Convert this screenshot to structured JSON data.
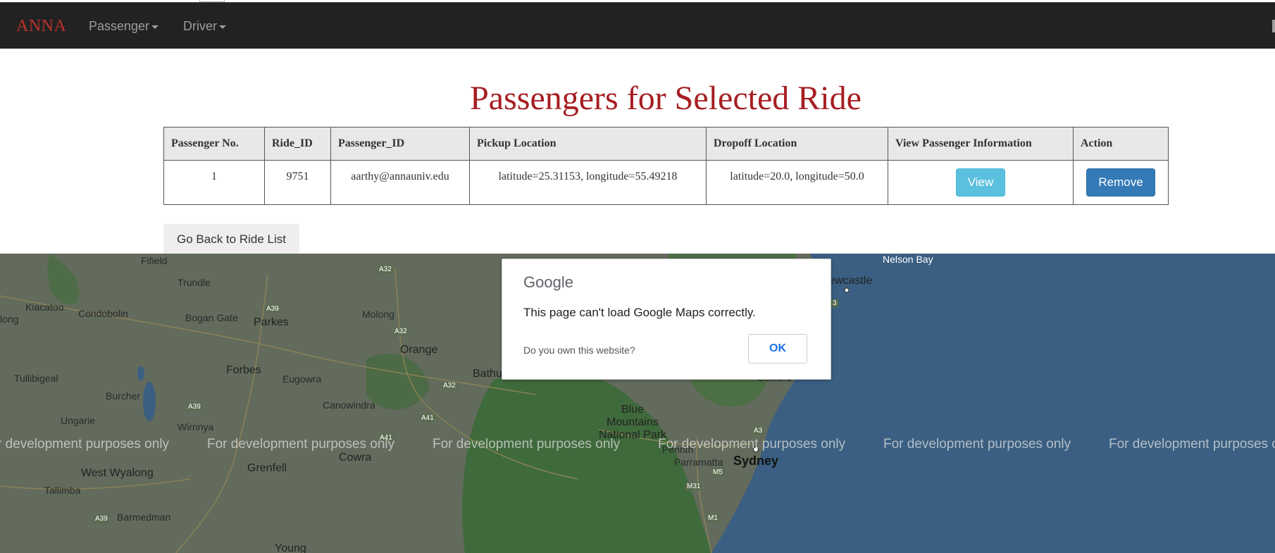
{
  "navbar": {
    "brand": "ANNA",
    "items": [
      {
        "label": "Passenger"
      },
      {
        "label": "Driver"
      }
    ]
  },
  "page": {
    "title": "Passengers for Selected Ride",
    "back_button": "Go Back to Ride List"
  },
  "table": {
    "headers": [
      "Passenger No.",
      "Ride_ID",
      "Passenger_ID",
      "Pickup Location",
      "Dropoff Location",
      "View Passenger Information",
      "Action"
    ],
    "rows": [
      {
        "passenger_no": "1",
        "ride_id": "9751",
        "passenger_id": "aarthy@annauniv.edu",
        "pickup": "latitude=25.31153, longitude=55.49218",
        "dropoff": "latitude=20.0, longitude=50.0",
        "view_label": "View",
        "remove_label": "Remove"
      }
    ]
  },
  "map": {
    "watermark": "For development purposes only",
    "watermark_partial_left": "r development purposes only",
    "watermark_partial_right": "For development purposes o",
    "places": {
      "fifield": "Fifield",
      "trundle": "Trundle",
      "kiacatoo": "Kiacatoo",
      "condobolin": "Condobolin",
      "bogan_gate": "Bogan Gate",
      "parkes": "Parkes",
      "molong": "Molong",
      "orange": "Orange",
      "forbes": "Forbes",
      "eugowra": "Eugowra",
      "tullibigeal": "Tullibigeal",
      "burcher": "Burcher",
      "canowindra": "Canowindra",
      "bathurst": "Bathu",
      "ungarie": "Ungarie",
      "wirrinya": "Wirrinya",
      "blue_mountains": "Blue\nMountains\nNational Park",
      "penrith": "Penrith",
      "grenfell": "Grenfell",
      "cowra": "Cowra",
      "west_wyalong": "West Wyalong",
      "tallimba": "Tallimba",
      "barmedman": "Barmedman",
      "young": "Young",
      "parramatta": "Parramatta",
      "sydney": "Sydney",
      "nelson_bay": "Nelson Bay",
      "newcastle": "ewcastle",
      "gosford": "Gosford",
      "long": "long"
    },
    "roads": [
      "A32",
      "A39",
      "A32",
      "A32",
      "A39",
      "A41",
      "A41",
      "A39",
      "A3",
      "M5",
      "M31",
      "M1",
      "3"
    ]
  },
  "dialog": {
    "logo": "Google",
    "message": "This page can't load Google Maps correctly.",
    "own_site": "Do you own this website?",
    "ok": "OK"
  }
}
